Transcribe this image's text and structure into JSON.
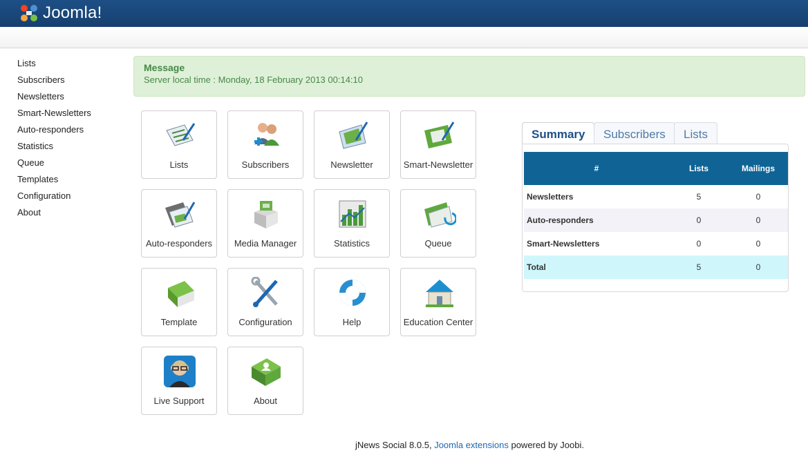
{
  "header": {
    "logo_text": "Joomla!"
  },
  "sidebar": {
    "items": [
      {
        "label": "Lists"
      },
      {
        "label": "Subscribers"
      },
      {
        "label": "Newsletters"
      },
      {
        "label": "Smart-Newsletters"
      },
      {
        "label": "Auto-responders"
      },
      {
        "label": "Statistics"
      },
      {
        "label": "Queue"
      },
      {
        "label": "Templates"
      },
      {
        "label": "Configuration"
      },
      {
        "label": "About"
      }
    ]
  },
  "message": {
    "heading": "Message",
    "text": "Server local time : Monday, 18 February 2013 00:14:10"
  },
  "tiles": [
    {
      "label": "Lists",
      "icon": "lists-icon"
    },
    {
      "label": "Subscribers",
      "icon": "subscribers-icon"
    },
    {
      "label": "Newsletter",
      "icon": "newsletter-icon"
    },
    {
      "label": "Smart-Newsletter",
      "icon": "smart-newsletter-icon"
    },
    {
      "label": "Auto-responders",
      "icon": "auto-responders-icon"
    },
    {
      "label": "Media Manager",
      "icon": "media-manager-icon"
    },
    {
      "label": "Statistics",
      "icon": "statistics-icon"
    },
    {
      "label": "Queue",
      "icon": "queue-icon"
    },
    {
      "label": "Template",
      "icon": "template-icon"
    },
    {
      "label": "Configuration",
      "icon": "configuration-icon"
    },
    {
      "label": "Help",
      "icon": "help-icon"
    },
    {
      "label": "Education Center",
      "icon": "education-center-icon"
    },
    {
      "label": "Live Support",
      "icon": "live-support-icon"
    },
    {
      "label": "About",
      "icon": "about-icon"
    }
  ],
  "tabs": [
    {
      "label": "Summary",
      "active": true
    },
    {
      "label": "Subscribers",
      "active": false
    },
    {
      "label": "Lists",
      "active": false
    }
  ],
  "summary": {
    "headers": [
      "#",
      "Lists",
      "Mailings"
    ],
    "rows": [
      {
        "name": "Newsletters",
        "lists": "5",
        "mailings": "0"
      },
      {
        "name": "Auto-responders",
        "lists": "0",
        "mailings": "0"
      },
      {
        "name": "Smart-Newsletters",
        "lists": "0",
        "mailings": "0"
      },
      {
        "name": "Total",
        "lists": "5",
        "mailings": "0"
      }
    ]
  },
  "footer": {
    "prefix": "jNews Social 8.0.5, ",
    "link": "Joomla extensions",
    "suffix": " powered by Joobi."
  },
  "colors": {
    "header_bg": "#1d4f86",
    "message_bg": "#dff0d8",
    "message_text": "#468847",
    "table_header_bg": "#0f6495",
    "total_row_bg": "#cff7fb",
    "link": "#1b67b3"
  }
}
